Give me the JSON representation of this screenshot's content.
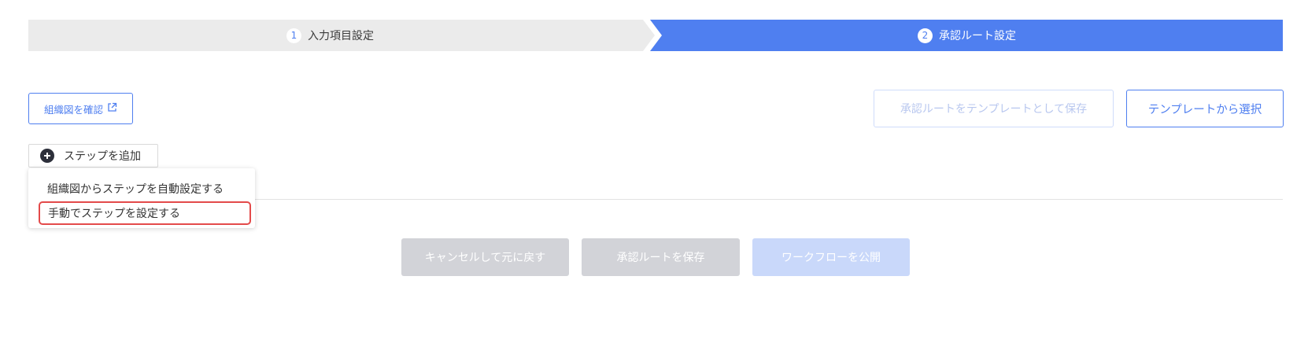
{
  "stepper": {
    "steps": [
      {
        "number": "1",
        "label": "入力項目設定",
        "state": "inactive"
      },
      {
        "number": "2",
        "label": "承認ルート設定",
        "state": "active"
      }
    ]
  },
  "toolbar": {
    "org_chart_label": "組織図を確認",
    "save_as_template_label": "承認ルートをテンプレートとして保存",
    "select_template_label": "テンプレートから選択",
    "add_step_label": "ステップを追加"
  },
  "add_step_menu": {
    "items": [
      {
        "label": "組織図からステップを自動設定する"
      },
      {
        "label": "手動でステップを設定する",
        "highlighted": true
      }
    ]
  },
  "footer": {
    "cancel_label": "キャンセルして元に戻す",
    "save_route_label": "承認ルートを保存",
    "publish_label": "ワークフローを公開"
  },
  "icons": {
    "org_chart": "external-link-icon",
    "add_step": "plus-circle-icon"
  },
  "colors": {
    "accent": "#4f7ff0",
    "inactive_step": "#ebebeb",
    "disabled_button": "#d2d3d8",
    "disabled_primary": "#c9d8fa",
    "highlight_border": "#e34a4a"
  }
}
